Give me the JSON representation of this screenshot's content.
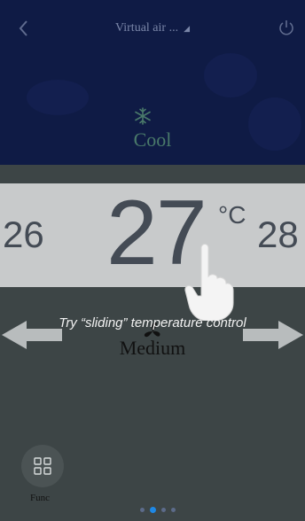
{
  "header": {
    "title": "Virtual air ...",
    "caret": "◢",
    "back_icon": "chevron-left-icon",
    "power_icon": "power-icon"
  },
  "mode": {
    "icon": "snowflake-icon",
    "label": "Cool"
  },
  "temperature": {
    "prev": "26",
    "current": "27",
    "unit": "°C",
    "next": "28"
  },
  "tutorial": {
    "hint": "Try “sliding” temperature control",
    "hand_icon": "pointing-hand-icon",
    "left_arrow_icon": "arrow-left-icon",
    "right_arrow_icon": "arrow-right-icon"
  },
  "fan": {
    "icon": "fan-icon",
    "label": "Medium"
  },
  "bottom": {
    "func_label": "Func",
    "func_icon": "grid-icon",
    "pages": 4,
    "active_page": 2
  },
  "colors": {
    "header_bg": "#0f1b45",
    "body_bg": "#3d4546",
    "band_bg": "#c8cacb",
    "mode_text": "#4a7a6a",
    "active_dot": "#1e88e5"
  }
}
